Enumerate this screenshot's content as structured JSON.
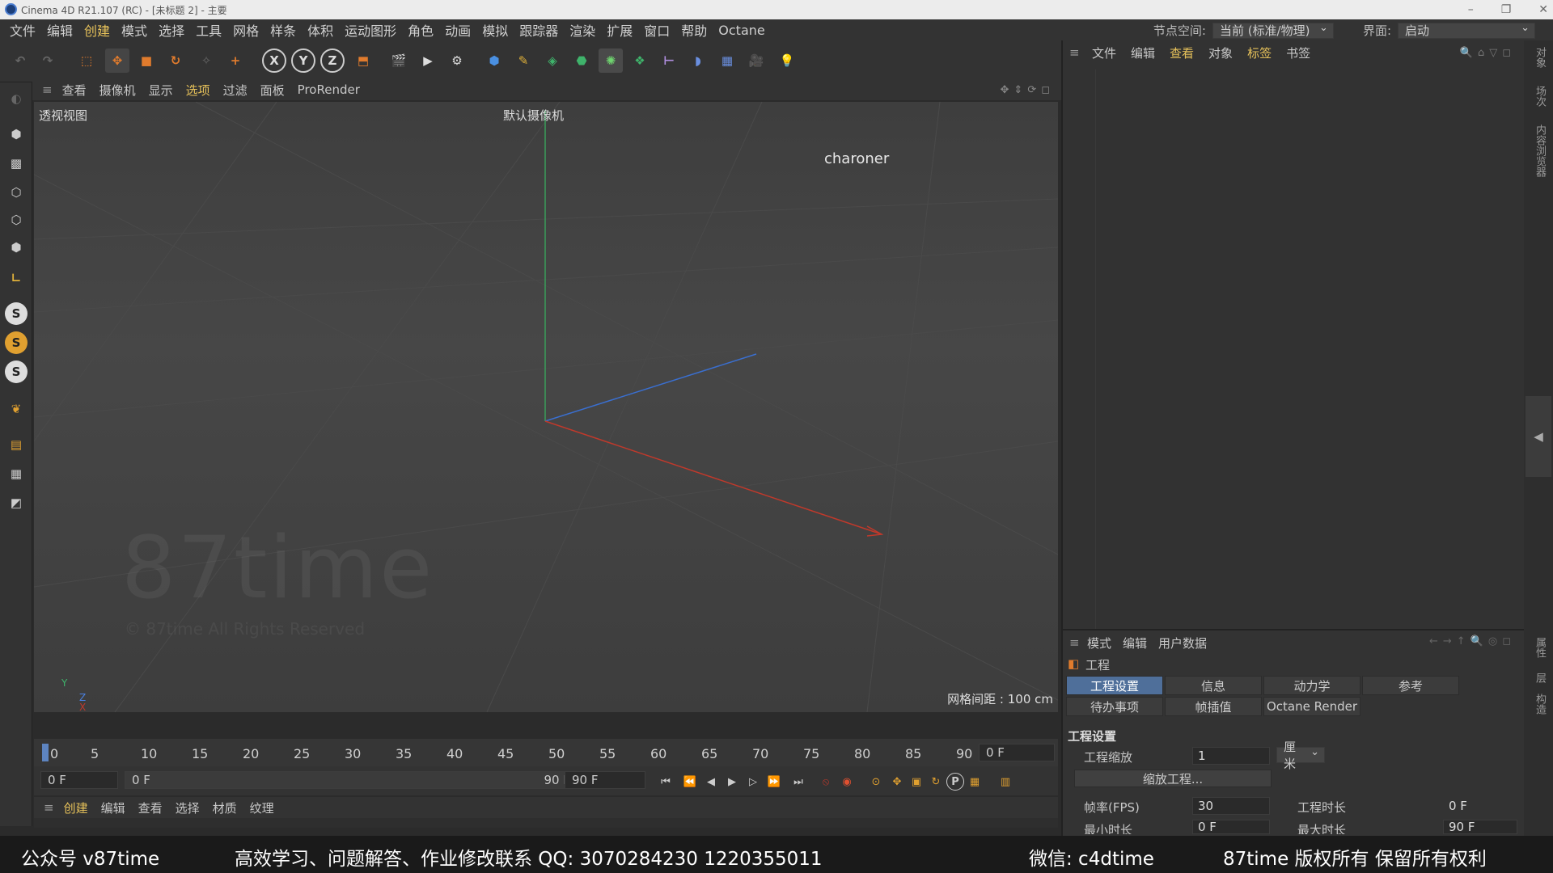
{
  "window": {
    "title": "Cinema 4D R21.107 (RC) - [未标题 2] - 主要"
  },
  "menubar": {
    "items": [
      {
        "label": "文件"
      },
      {
        "label": "编辑"
      },
      {
        "label": "创建",
        "hl": true
      },
      {
        "label": "模式"
      },
      {
        "label": "选择"
      },
      {
        "label": "工具"
      },
      {
        "label": "网格"
      },
      {
        "label": "样条"
      },
      {
        "label": "体积"
      },
      {
        "label": "运动图形"
      },
      {
        "label": "角色"
      },
      {
        "label": "动画"
      },
      {
        "label": "模拟"
      },
      {
        "label": "跟踪器"
      },
      {
        "label": "渲染"
      },
      {
        "label": "扩展"
      },
      {
        "label": "窗口"
      },
      {
        "label": "帮助"
      },
      {
        "label": "Octane"
      }
    ],
    "node_space_label": "节点空间:",
    "node_space_value": "当前 (标准/物理)",
    "layout_label": "界面:",
    "layout_value": "启动"
  },
  "toolbar": {
    "x_label": "X",
    "y_label": "Y",
    "z_label": "Z"
  },
  "left_tools": {
    "s1": "S",
    "s2": "S",
    "s3": "S"
  },
  "viewport_menu": {
    "items": [
      {
        "label": "查看"
      },
      {
        "label": "摄像机"
      },
      {
        "label": "显示"
      },
      {
        "label": "选项",
        "hl": true
      },
      {
        "label": "过滤"
      },
      {
        "label": "面板"
      },
      {
        "label": "ProRender"
      }
    ]
  },
  "viewport": {
    "view_name": "透视视图",
    "camera_name": "默认摄像机",
    "user_label": "charoner",
    "watermark": "87time",
    "watermark_sub": "© 87time All Rights Reserved",
    "grid_spacing": "网格间距 : 100 cm",
    "axis_y": "Y",
    "axis_z": "Z",
    "axis_x": "X"
  },
  "timeline": {
    "ticks": [
      "0",
      "5",
      "10",
      "15",
      "20",
      "25",
      "30",
      "35",
      "40",
      "45",
      "50",
      "55",
      "60",
      "65",
      "70",
      "75",
      "80",
      "85",
      "90"
    ],
    "current_frame": "0 F"
  },
  "anim_bar": {
    "start": "0 F",
    "range_start": "0 F",
    "range_end": "90 F",
    "end": "90 F",
    "p_button": "P"
  },
  "material_menu": {
    "items": [
      {
        "label": "创建",
        "hl": true
      },
      {
        "label": "编辑"
      },
      {
        "label": "查看"
      },
      {
        "label": "选择"
      },
      {
        "label": "材质"
      },
      {
        "label": "纹理"
      }
    ]
  },
  "object_manager": {
    "items": [
      {
        "label": "文件"
      },
      {
        "label": "编辑"
      },
      {
        "label": "查看",
        "hl": true
      },
      {
        "label": "对象"
      },
      {
        "label": "标签",
        "hl": true
      },
      {
        "label": "书签"
      }
    ]
  },
  "attribute_manager": {
    "menu": [
      {
        "label": "模式"
      },
      {
        "label": "编辑"
      },
      {
        "label": "用户数据"
      }
    ],
    "object_title": "工程",
    "tabs_row1": [
      "工程设置",
      "信息",
      "动力学",
      "参考"
    ],
    "tabs_row2": [
      "待办事项",
      "帧插值",
      "Octane Render"
    ],
    "section_title": "工程设置",
    "project_scale_label": "工程缩放",
    "project_scale_value": "1",
    "project_scale_unit": "厘米",
    "scale_button": "缩放工程...",
    "fps_label": "帧率(FPS)",
    "fps_value": "30",
    "duration_label": "工程时长",
    "duration_value": "0 F",
    "min_time_label": "最小时长",
    "min_time_value": "0 F",
    "max_time_label": "最大时长",
    "max_time_value": "90 F"
  },
  "right_strip": {
    "tab1": "对象",
    "tab2": "场次",
    "tab3": "内容浏览器",
    "tab4": "属性",
    "tab5": "层",
    "tab6": "构造"
  },
  "overlay": {
    "left": "公众号 v87time",
    "middle": "高效学习、问题解答、作业修改联系 QQ: 3070284230   1220355011",
    "wechat": "微信: c4dtime",
    "rights": "87time 版权所有  保留所有权利"
  },
  "colors": {
    "accent_yellow": "#e6c15a",
    "tab_active": "#4f6f9a",
    "axis_x": "#c0392b",
    "axis_y": "#27ae60",
    "axis_z": "#2e6fd0"
  }
}
